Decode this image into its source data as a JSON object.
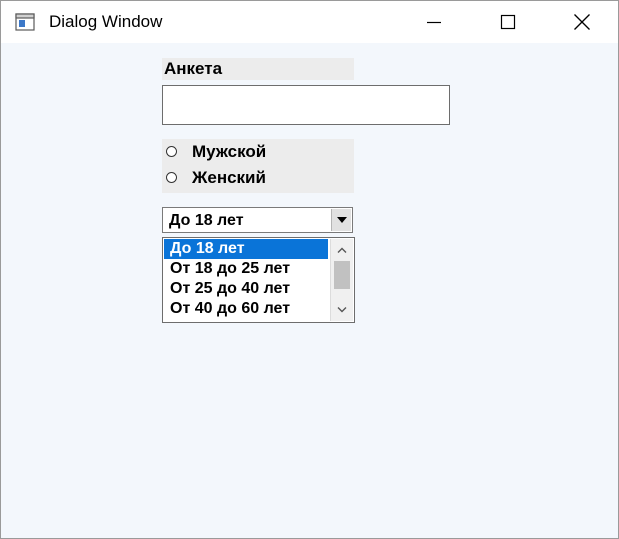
{
  "window": {
    "title": "Dialog Window",
    "controls": [
      "minimize-button",
      "maximize-button",
      "close-button"
    ]
  },
  "form": {
    "label": "Анкета",
    "text_input": {
      "value": "",
      "placeholder": ""
    },
    "gender": {
      "options": [
        "Мужской",
        "Женский"
      ],
      "selected": null
    },
    "age_combo": {
      "selected": "До 18 лет"
    },
    "age_list": {
      "items": [
        "До 18 лет",
        "От 18 до 25 лет",
        "От 25 до 40 лет",
        "От 40 до 60 лет"
      ],
      "selected_index": 0
    }
  },
  "colors": {
    "selection": "#0a74d8",
    "client_bg": "#f3f7fc",
    "group_bg": "#ececec"
  }
}
